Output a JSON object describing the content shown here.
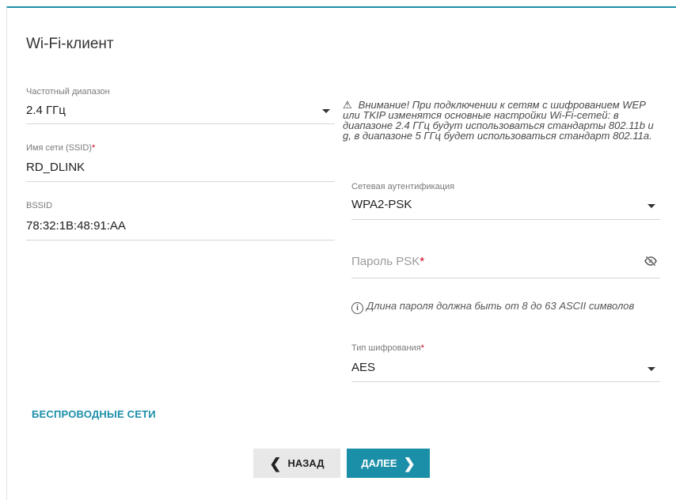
{
  "page": {
    "title": "Wi-Fi-клиент"
  },
  "left": {
    "band": {
      "label": "Частотный диапазон",
      "value": "2.4 ГГц"
    },
    "ssid": {
      "label": "Имя сети (SSID)",
      "required": "*",
      "value": "RD_DLINK"
    },
    "bssid": {
      "label": "BSSID",
      "value": "78:32:1B:48:91:AA"
    }
  },
  "right": {
    "warning": "Внимание! При подключении к сетям с шифрованием WEP или TKIP изменятся основные настройки Wi-Fi-сетей: в диапазоне 2.4 ГГц будут использоваться стандарты 802.11b и g, в диапазоне 5 ГГц будет использоваться стандарт 802.11a.",
    "auth": {
      "label": "Сетевая аутентификация",
      "value": "WPA2-PSK"
    },
    "psk": {
      "placeholder": "Пароль PSK",
      "required": "*"
    },
    "hint": "Длина пароля должна быть от 8 до 63 ASCII символов",
    "cipher": {
      "label": "Тип шифрования",
      "required": "*",
      "value": "AES"
    }
  },
  "link": {
    "label": "БЕСПРОВОДНЫЕ СЕТИ"
  },
  "buttons": {
    "back": "НАЗАД",
    "next": "ДАЛЕЕ"
  },
  "icons": {
    "warning": "warning-icon",
    "info": "info-icon",
    "eye": "eye-slash-icon",
    "dropdown": "chevron-down-icon"
  },
  "colors": {
    "accent": "#1b8fa8",
    "required": "#d0021b"
  }
}
